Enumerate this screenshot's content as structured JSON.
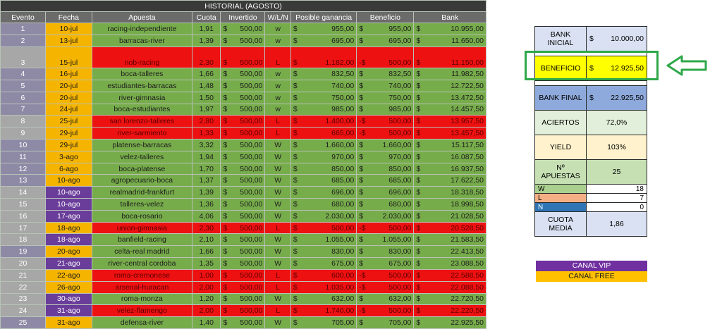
{
  "table": {
    "title": "HISTORIAL (AGOSTO)",
    "headers": [
      "Evento",
      "Fecha",
      "Apuesta",
      "Cuota",
      "Invertido",
      "W/L/N",
      "Posible ganancia",
      "Beneficio",
      "Bank"
    ],
    "rows": [
      {
        "ev": "1",
        "fecha": "10-jul",
        "apuesta": "racing-independiente",
        "cuota": "1,91",
        "inv": "500,00",
        "wl": "w",
        "pos": "955,00",
        "ben_sign": "$",
        "ben": "955,00",
        "bank": "10.955,00",
        "result": "win",
        "fcolor": "jul"
      },
      {
        "ev": "2",
        "fecha": "13-jul",
        "apuesta": "barracas-river",
        "cuota": "1,39",
        "inv": "500,00",
        "wl": "w",
        "pos": "695,00",
        "ben_sign": "$",
        "ben": "695,00",
        "bank": "11.650,00",
        "result": "win",
        "fcolor": "jul"
      },
      {
        "ev": "3",
        "fecha": "15-jul",
        "apuesta": "nob-racing",
        "cuota": "2,30",
        "inv": "500,00",
        "wl": "L",
        "pos": "1.182,00",
        "ben_sign": "-$",
        "ben": "500,00",
        "bank": "11.150,00",
        "result": "loss",
        "fcolor": "jul"
      },
      {
        "ev": "4",
        "fecha": "16-jul",
        "apuesta": "boca-talleres",
        "cuota": "1,66",
        "inv": "500,00",
        "wl": "w",
        "pos": "832,50",
        "ben_sign": "$",
        "ben": "832,50",
        "bank": "11.982,50",
        "result": "win",
        "fcolor": "jul"
      },
      {
        "ev": "5",
        "fecha": "20-jul",
        "apuesta": "estudiantes-barracas",
        "cuota": "1,48",
        "inv": "500,00",
        "wl": "w",
        "pos": "740,00",
        "ben_sign": "$",
        "ben": "740,00",
        "bank": "12.722,50",
        "result": "win",
        "fcolor": "jul"
      },
      {
        "ev": "6",
        "fecha": "20-jul",
        "apuesta": "river-gimnasia",
        "cuota": "1,50",
        "inv": "500,00",
        "wl": "w",
        "pos": "750,00",
        "ben_sign": "$",
        "ben": "750,00",
        "bank": "13.472,50",
        "result": "win",
        "fcolor": "jul"
      },
      {
        "ev": "7",
        "fecha": "24-jul",
        "apuesta": "boca-estudiantes",
        "cuota": "1,97",
        "inv": "500,00",
        "wl": "w",
        "pos": "985,00",
        "ben_sign": "$",
        "ben": "985,00",
        "bank": "14.457,50",
        "result": "win",
        "fcolor": "jul"
      },
      {
        "ev": "8",
        "fecha": "25-jul",
        "apuesta": "san lorenzo-talleres",
        "cuota": "2,80",
        "inv": "500,00",
        "wl": "L",
        "pos": "1.400,00",
        "ben_sign": "-$",
        "ben": "500,00",
        "bank": "13.957,50",
        "result": "loss",
        "fcolor": "jul"
      },
      {
        "ev": "9",
        "fecha": "29-jul",
        "apuesta": "river-sarmiento",
        "cuota": "1,33",
        "inv": "500,00",
        "wl": "L",
        "pos": "665,00",
        "ben_sign": "-$",
        "ben": "500,00",
        "bank": "13.457,50",
        "result": "loss",
        "fcolor": "jul"
      },
      {
        "ev": "10",
        "fecha": "29-jul",
        "apuesta": "platense-barracas",
        "cuota": "3,32",
        "inv": "500,00",
        "wl": "W",
        "pos": "1.660,00",
        "ben_sign": "$",
        "ben": "1.660,00",
        "bank": "15.117,50",
        "result": "win",
        "fcolor": "jul"
      },
      {
        "ev": "11",
        "fecha": "3-ago",
        "apuesta": "velez-talleres",
        "cuota": "1,94",
        "inv": "500,00",
        "wl": "W",
        "pos": "970,00",
        "ben_sign": "$",
        "ben": "970,00",
        "bank": "16.087,50",
        "result": "win",
        "fcolor": "ago"
      },
      {
        "ev": "12",
        "fecha": "6-ago",
        "apuesta": "boca-platense",
        "cuota": "1,70",
        "inv": "500,00",
        "wl": "W",
        "pos": "850,00",
        "ben_sign": "$",
        "ben": "850,00",
        "bank": "16.937,50",
        "result": "win",
        "fcolor": "ago"
      },
      {
        "ev": "13",
        "fecha": "10-ago",
        "apuesta": "agropecuario-boca",
        "cuota": "1,37",
        "inv": "500,00",
        "wl": "W",
        "pos": "685,00",
        "ben_sign": "$",
        "ben": "685,00",
        "bank": "17.622,50",
        "result": "win",
        "fcolor": "ago"
      },
      {
        "ev": "14",
        "fecha": "10-ago",
        "apuesta": "realmadrid-frankfurt",
        "cuota": "1,39",
        "inv": "500,00",
        "wl": "W",
        "pos": "696,00",
        "ben_sign": "$",
        "ben": "696,00",
        "bank": "18.318,50",
        "result": "win",
        "fcolor": "purple"
      },
      {
        "ev": "15",
        "fecha": "10-ago",
        "apuesta": "talleres-velez",
        "cuota": "1,36",
        "inv": "500,00",
        "wl": "W",
        "pos": "680,00",
        "ben_sign": "$",
        "ben": "680,00",
        "bank": "18.998,50",
        "result": "win",
        "fcolor": "purple"
      },
      {
        "ev": "16",
        "fecha": "17-ago",
        "apuesta": "boca-rosario",
        "cuota": "4,06",
        "inv": "500,00",
        "wl": "W",
        "pos": "2.030,00",
        "ben_sign": "$",
        "ben": "2.030,00",
        "bank": "21.028,50",
        "result": "win",
        "fcolor": "purple"
      },
      {
        "ev": "17",
        "fecha": "18-ago",
        "apuesta": "union-gimnasia",
        "cuota": "2,30",
        "inv": "500,00",
        "wl": "L",
        "pos": "500,00",
        "ben_sign": "-$",
        "ben": "500,00",
        "bank": "20.528,50",
        "result": "loss",
        "fcolor": "ago"
      },
      {
        "ev": "18",
        "fecha": "18-ago",
        "apuesta": "banfield-racing",
        "cuota": "2,10",
        "inv": "500,00",
        "wl": "W",
        "pos": "1.055,00",
        "ben_sign": "$",
        "ben": "1.055,00",
        "bank": "21.583,50",
        "result": "win",
        "fcolor": "purple"
      },
      {
        "ev": "19",
        "fecha": "20-ago",
        "apuesta": "celta-real madrid",
        "cuota": "1,66",
        "inv": "500,00",
        "wl": "W",
        "pos": "830,00",
        "ben_sign": "$",
        "ben": "830,00",
        "bank": "22.413,50",
        "result": "win",
        "fcolor": "ago"
      },
      {
        "ev": "20",
        "fecha": "21-ago",
        "apuesta": "river-central cordoba",
        "cuota": "1,35",
        "inv": "500,00",
        "wl": "W",
        "pos": "675,00",
        "ben_sign": "$",
        "ben": "675,00",
        "bank": "23.088,50",
        "result": "win",
        "fcolor": "purple"
      },
      {
        "ev": "21",
        "fecha": "22-ago",
        "apuesta": "roma-cremonese",
        "cuota": "1,00",
        "inv": "500,00",
        "wl": "L",
        "pos": "600,00",
        "ben_sign": "-$",
        "ben": "500,00",
        "bank": "22.588,50",
        "result": "loss",
        "fcolor": "ago"
      },
      {
        "ev": "22",
        "fecha": "26-ago",
        "apuesta": "arsenal-huracan",
        "cuota": "2,00",
        "inv": "500,00",
        "wl": "L",
        "pos": "1.035,00",
        "ben_sign": "-$",
        "ben": "500,00",
        "bank": "22.088,50",
        "result": "loss",
        "fcolor": "ago"
      },
      {
        "ev": "23",
        "fecha": "30-ago",
        "apuesta": "roma-monza",
        "cuota": "1,20",
        "inv": "500,00",
        "wl": "W",
        "pos": "632,00",
        "ben_sign": "$",
        "ben": "632,00",
        "bank": "22.720,50",
        "result": "win",
        "fcolor": "purple"
      },
      {
        "ev": "24",
        "fecha": "31-ago",
        "apuesta": "velez-flamengo",
        "cuota": "2,00",
        "inv": "500,00",
        "wl": "L",
        "pos": "1.740,00",
        "ben_sign": "-$",
        "ben": "500,00",
        "bank": "22.220,50",
        "result": "loss",
        "fcolor": "purple"
      },
      {
        "ev": "25",
        "fecha": "31-ago",
        "apuesta": "defensa-river",
        "cuota": "1,40",
        "inv": "500,00",
        "wl": "W",
        "pos": "705,00",
        "ben_sign": "$",
        "ben": "705,00",
        "bank": "22.925,50",
        "result": "win",
        "fcolor": "ago"
      }
    ]
  },
  "summary": {
    "bank_inicial_label": "BANK INICIAL",
    "bank_inicial_value": "10.000,00",
    "beneficio_label": "BENEFICIO",
    "beneficio_value": "12.925,50",
    "bank_final_label": "BANK FINAL",
    "bank_final_value": "22.925,50",
    "aciertos_label": "ACIERTOS",
    "aciertos_value": "72,0%",
    "yield_label": "YIELD",
    "yield_value": "103%",
    "apuestas_label": "Nº APUESTAS",
    "apuestas_value": "25",
    "w_label": "W",
    "w_value": "18",
    "l_label": "L",
    "l_value": "7",
    "n_label": "N",
    "n_value": "0",
    "cuota_media_label": "CUOTA MEDIA",
    "cuota_media_value": "1,86",
    "currency": "$"
  },
  "canal_vip": "CANAL VIP",
  "canal_free": "CANAL FREE",
  "colors": {
    "win": "#77ac4b",
    "loss": "#ee1111",
    "highlight": "#2ea84a",
    "beneficio": "#ffff00"
  }
}
